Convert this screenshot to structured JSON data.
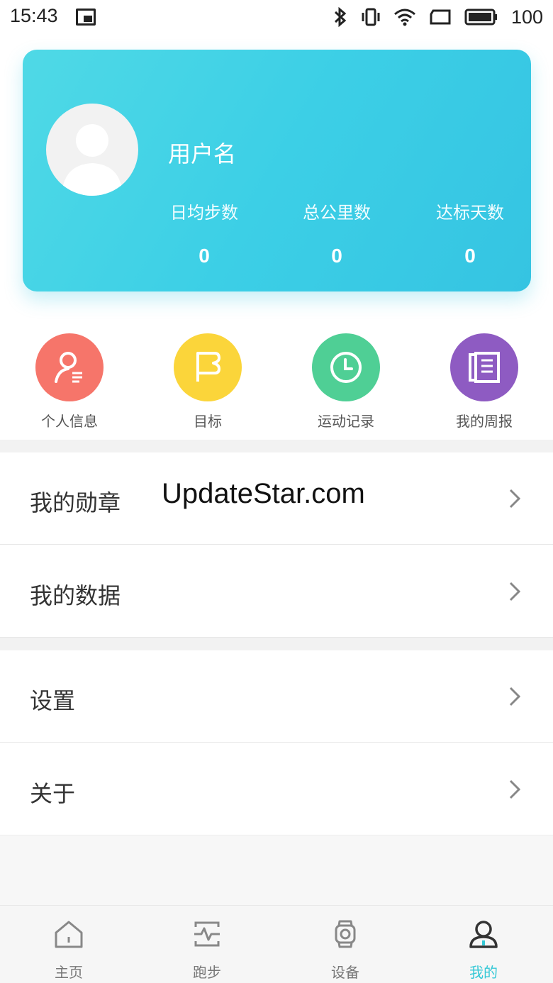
{
  "status_bar": {
    "time": "15:43",
    "battery": "100"
  },
  "profile": {
    "username": "用户名",
    "stats": [
      {
        "label": "日均步数",
        "value": "0"
      },
      {
        "label": "总公里数",
        "value": "0"
      },
      {
        "label": "达标天数",
        "value": "0"
      }
    ]
  },
  "quick_actions": [
    {
      "label": "个人信息",
      "icon": "user-info-icon",
      "color": "#f6756a"
    },
    {
      "label": "目标",
      "icon": "flag-icon",
      "color": "#fbd53a"
    },
    {
      "label": "运动记录",
      "icon": "clock-icon",
      "color": "#4fcf95"
    },
    {
      "label": "我的周报",
      "icon": "report-icon",
      "color": "#8e5bc2"
    }
  ],
  "menu_group1": [
    {
      "label": "我的勋章"
    },
    {
      "label": "我的数据"
    }
  ],
  "menu_group2": [
    {
      "label": "设置"
    },
    {
      "label": "关于"
    }
  ],
  "watermark": "UpdateStar.com",
  "bottom_nav": [
    {
      "label": "主页",
      "icon": "home-icon"
    },
    {
      "label": "跑步",
      "icon": "run-icon"
    },
    {
      "label": "设备",
      "icon": "watch-icon"
    },
    {
      "label": "我的",
      "icon": "profile-icon",
      "active": true
    }
  ],
  "colors": {
    "accent": "#34c8d6",
    "card": "#3ccfe6"
  }
}
